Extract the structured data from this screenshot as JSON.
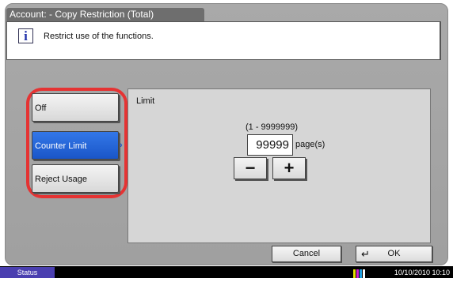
{
  "window": {
    "title": "Account: - Copy Restriction (Total)"
  },
  "info": {
    "message": "Restrict use of the functions.",
    "icon": "info-icon"
  },
  "options": [
    {
      "label": "Off",
      "selected": false
    },
    {
      "label": "Counter Limit",
      "selected": true
    },
    {
      "label": "Reject Usage",
      "selected": false
    }
  ],
  "limit": {
    "title": "Limit",
    "range": "(1 - 9999999)",
    "value": "99999",
    "unit": "page(s)",
    "minus_label": "−",
    "plus_label": "+"
  },
  "actions": {
    "cancel": "Cancel",
    "ok": "OK"
  },
  "statusbar": {
    "status_label": "Status",
    "datetime": "10/10/2010  10:10"
  },
  "colors": {
    "selected": "#1a56c8",
    "highlight_outline": "#e53333",
    "status_button": "#4a3fb0"
  }
}
